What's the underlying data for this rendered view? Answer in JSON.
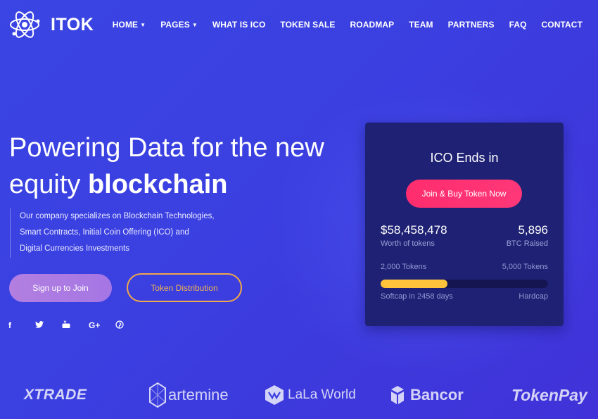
{
  "brand": {
    "name": "ITOK"
  },
  "nav": {
    "items": [
      {
        "label": "HOME",
        "dropdown": true
      },
      {
        "label": "PAGES",
        "dropdown": true
      },
      {
        "label": "WHAT IS ICO",
        "dropdown": false
      },
      {
        "label": "TOKEN SALE",
        "dropdown": false
      },
      {
        "label": "ROADMAP",
        "dropdown": false
      },
      {
        "label": "TEAM",
        "dropdown": false
      },
      {
        "label": "PARTNERS",
        "dropdown": false
      },
      {
        "label": "FAQ",
        "dropdown": false
      },
      {
        "label": "CONTACT",
        "dropdown": false
      }
    ]
  },
  "hero": {
    "title_line1": "Powering Data for the new",
    "title_line2_plain": "equity ",
    "title_line2_bold": "blockchain",
    "description": [
      "Our company specializes on Blockchain Technologies,",
      "Smart Contracts, Initial Coin Offering (ICO) and",
      "Digital Currencies Investments"
    ],
    "signup_label": "Sign up to Join",
    "token_label": "Token Distribution"
  },
  "socials": [
    {
      "icon": "facebook-icon",
      "glyph": "f"
    },
    {
      "icon": "twitter-icon",
      "glyph": "🐦"
    },
    {
      "icon": "youtube-icon",
      "glyph": "▶"
    },
    {
      "icon": "google-plus-icon",
      "glyph": "G+"
    },
    {
      "icon": "pinterest-icon",
      "glyph": "℗"
    }
  ],
  "ico": {
    "title": "ICO Ends in",
    "buy_label": "Join & Buy Token Now",
    "worth_value": "$58,458,478",
    "worth_label": "Worth of tokens",
    "btc_value": "5,896",
    "btc_label": "BTC Raised",
    "tokens_left": "2,000 Tokens",
    "tokens_right": "5,000 Tokens",
    "progress_fraction": 0.4,
    "softcap": "Softcap in 2458 days",
    "hardcap": "Hardcap"
  },
  "partners": [
    {
      "name": "XTRADE",
      "icon": ""
    },
    {
      "name": "artemine",
      "icon": "hexagon-logo-icon"
    },
    {
      "name": "LaLa World",
      "icon": "lala-world-logo-icon"
    },
    {
      "name": "Bancor",
      "icon": "bancor-logo-icon"
    },
    {
      "name": "TokenPay",
      "icon": ""
    }
  ],
  "colors": {
    "background": "#3b3fe0",
    "card": "#1f2274",
    "accent_pink": "#ff2d6e",
    "accent_orange": "#f0a84a",
    "progress": "#fec33a",
    "signup": "#b27fe0"
  }
}
